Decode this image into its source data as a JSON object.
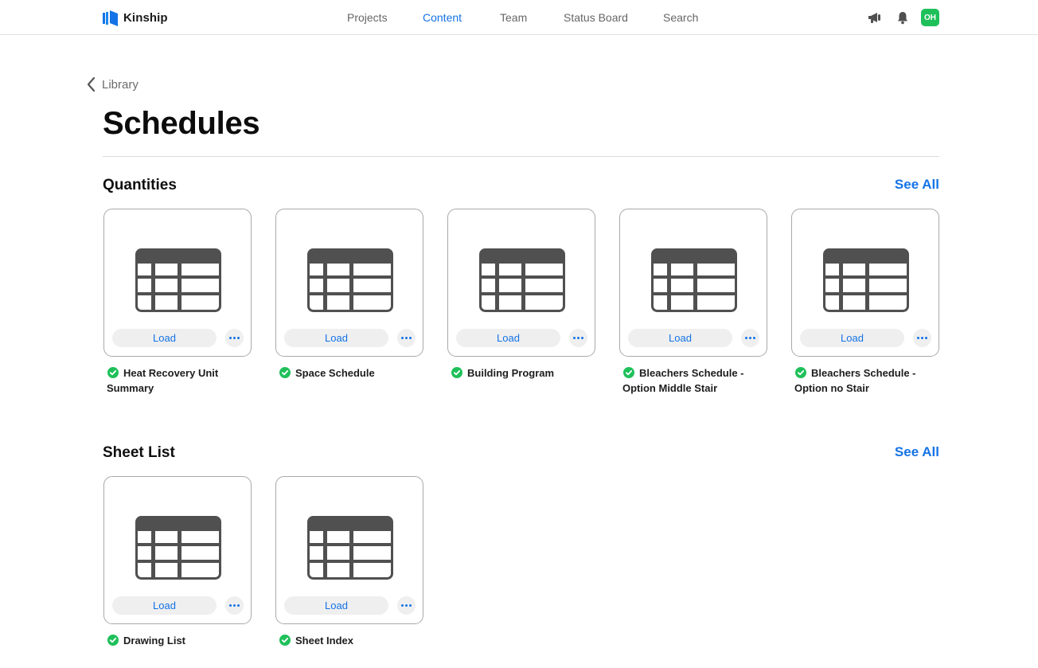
{
  "app": {
    "name": "Kinship",
    "user_initials": "OH"
  },
  "nav": {
    "items": [
      {
        "label": "Projects",
        "active": false
      },
      {
        "label": "Content",
        "active": true
      },
      {
        "label": "Team",
        "active": false
      },
      {
        "label": "Status Board",
        "active": false
      },
      {
        "label": "Search",
        "active": false
      }
    ],
    "icons": [
      "megaphone-icon",
      "bell-icon"
    ]
  },
  "breadcrumb": {
    "back_label": "Library"
  },
  "page": {
    "title": "Schedules"
  },
  "sections": [
    {
      "title": "Quantities",
      "see_all": "See All",
      "items": [
        {
          "line1": "Heat Recovery Unit",
          "line2": "Summary",
          "load": "Load",
          "status": "check-circle-icon"
        },
        {
          "line1": "Space Schedule",
          "line2": "",
          "load": "Load",
          "status": "check-circle-icon"
        },
        {
          "line1": "Building Program",
          "line2": "",
          "load": "Load",
          "status": "check-circle-icon"
        },
        {
          "line1": "Bleachers Schedule -",
          "line2": "Option Middle Stair",
          "load": "Load",
          "status": "check-circle-icon"
        },
        {
          "line1": "Bleachers Schedule -",
          "line2": "Option no Stair",
          "load": "Load",
          "status": "check-circle-icon"
        }
      ]
    },
    {
      "title": "Sheet List",
      "see_all": "See All",
      "items": [
        {
          "line1": "Drawing List",
          "line2": "",
          "load": "Load",
          "status": "check-circle-icon"
        },
        {
          "line1": "Sheet Index",
          "line2": "",
          "load": "Load",
          "status": "check-circle-icon"
        }
      ]
    }
  ],
  "colors": {
    "accent": "#1473e6",
    "success": "#1fc05a",
    "icon_gray": "#505050"
  }
}
